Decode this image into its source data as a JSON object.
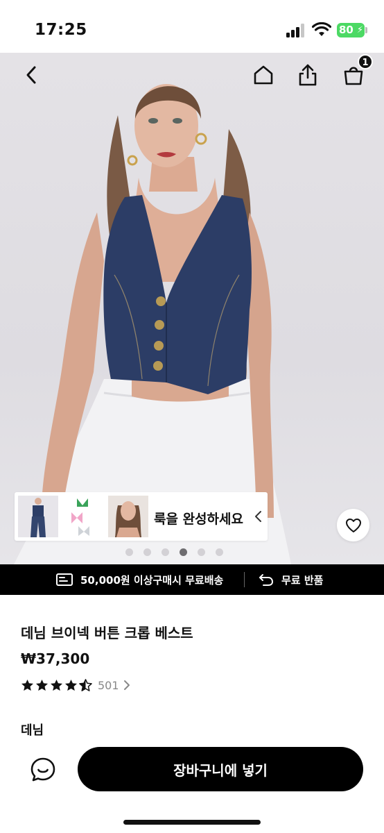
{
  "status_bar": {
    "time": "17:25",
    "battery": "80"
  },
  "nav": {
    "back_icon": "chevron-left-icon",
    "home_icon": "home-icon",
    "share_icon": "share-icon",
    "cart_icon": "shopping-bag-icon",
    "cart_count": "1"
  },
  "gallery": {
    "image_count": 6,
    "active_index": 3
  },
  "complete_look": {
    "label": "룩을 완성하세요"
  },
  "promo": {
    "shipping": "50,000원 이상구매시 무료배송",
    "returns": "무료 반품"
  },
  "product": {
    "title": "데님 브이넥 버튼 크롭 베스트",
    "price": "₩37,300",
    "rating": 4.5,
    "review_count": "501",
    "color": "데님"
  },
  "actions": {
    "add_to_cart": "장바구니에 넣기"
  },
  "colors": {
    "accent": "#000000",
    "battery": "#4cd964",
    "denim": "#2c3d66"
  }
}
